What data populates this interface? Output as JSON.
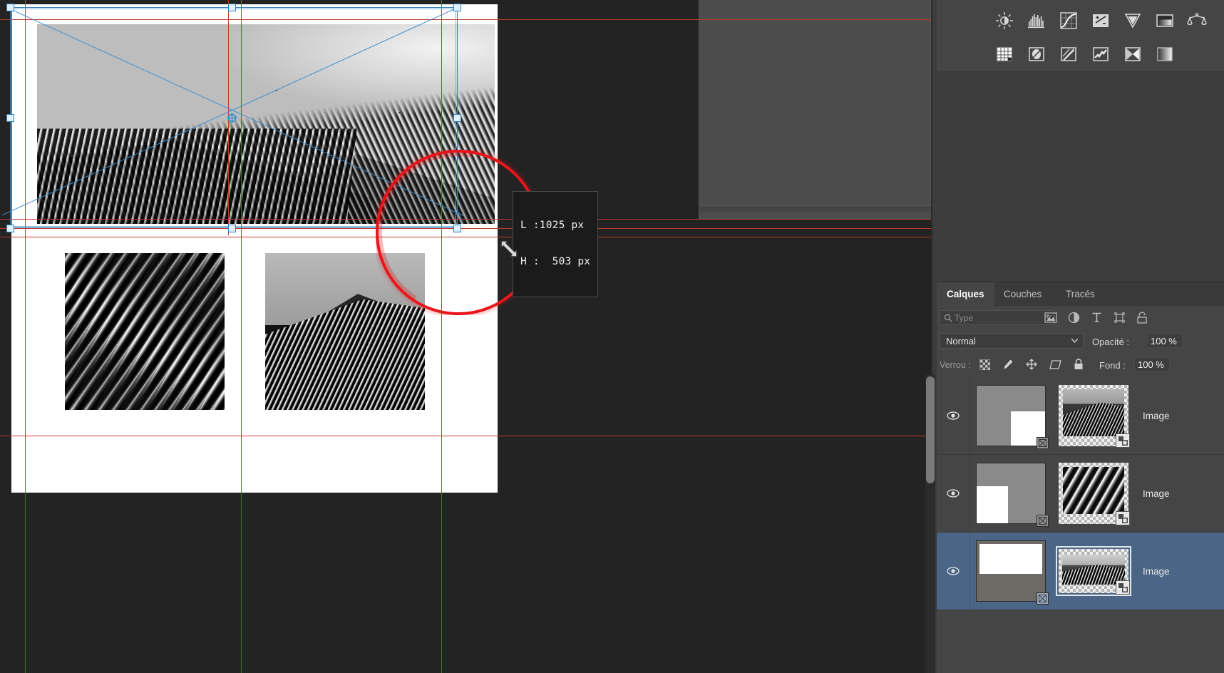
{
  "app": {
    "name": "photoshop",
    "theme_bg": "#232323",
    "panel_bg": "#454545",
    "accent_selected": "#4a6585"
  },
  "canvas": {
    "transform_tooltip": {
      "width_label": "L :",
      "width_value": "1025 px",
      "height_label": "H :",
      "height_value": "503 px",
      "line1": "L :1025 px",
      "line2": "H :  503 px"
    },
    "cursor": "resize-diagonal-cursor",
    "annotation": {
      "shape": "circle",
      "color": "#e8161a"
    },
    "guides_color": "#c0392b",
    "transform_handle_color": "#69b2e8"
  },
  "adjustments": {
    "row1": [
      {
        "name": "brightness-contrast-icon",
        "label": "Luminosité/Contraste"
      },
      {
        "name": "levels-icon",
        "label": "Niveaux"
      },
      {
        "name": "curves-icon",
        "label": "Courbes"
      },
      {
        "name": "exposure-icon",
        "label": "Exposition"
      },
      {
        "name": "vibrance-icon",
        "label": "Vibrance"
      },
      {
        "name": "photo-filter-icon",
        "label": "Filtre photo"
      },
      {
        "name": "color-balance-icon",
        "label": "Balance des couleurs"
      }
    ],
    "row2": [
      {
        "name": "black-white-icon",
        "label": "Noir et blanc"
      },
      {
        "name": "hue-saturation-icon",
        "label": "Teinte/Saturation"
      },
      {
        "name": "color-lookup-icon",
        "label": "Recherche de couleur"
      },
      {
        "name": "selective-color-icon",
        "label": "Correction sélective"
      },
      {
        "name": "threshold-icon",
        "label": "Seuil"
      },
      {
        "name": "gradient-map-icon",
        "label": "Dégradé"
      }
    ]
  },
  "layers_panel": {
    "tabs": [
      {
        "label": "Calques",
        "active": true
      },
      {
        "label": "Couches",
        "active": false
      },
      {
        "label": "Tracés",
        "active": false
      }
    ],
    "filter": {
      "placeholder": "Type",
      "search_icon": "search-icon",
      "caret_icon": "chevron-down-icon",
      "type_icons": [
        {
          "name": "filter-pixel-icon"
        },
        {
          "name": "filter-adjustment-icon"
        },
        {
          "name": "filter-type-icon"
        },
        {
          "name": "filter-shape-icon"
        },
        {
          "name": "filter-smartobject-icon"
        }
      ]
    },
    "blend_mode": "Normal",
    "opacity_label": "Opacité :",
    "opacity_value": "100 %",
    "lock_label": "Verrou :",
    "lock_icons": [
      {
        "name": "lock-transparent-pixels-icon"
      },
      {
        "name": "lock-image-pixels-icon"
      },
      {
        "name": "lock-position-icon"
      },
      {
        "name": "lock-artboard-nesting-icon"
      },
      {
        "name": "lock-all-icon"
      }
    ],
    "fill_label": "Fond :",
    "fill_value": "100 %",
    "layers": [
      {
        "name": "Image",
        "visible": true,
        "selected": false,
        "visibility_icon": "eye-icon",
        "mask_badge": "link-broken-icon",
        "smart_object_badge": "smart-object-icon",
        "mask_rect": "bottom-right"
      },
      {
        "name": "Image",
        "visible": true,
        "selected": false,
        "visibility_icon": "eye-icon",
        "mask_badge": "link-broken-icon",
        "smart_object_badge": "smart-object-icon",
        "mask_rect": "bottom-left"
      },
      {
        "name": "Image",
        "visible": true,
        "selected": true,
        "visibility_icon": "eye-icon",
        "mask_badge": "link-broken-icon",
        "smart_object_badge": "smart-object-icon",
        "mask_rect": "top-wide"
      }
    ]
  }
}
